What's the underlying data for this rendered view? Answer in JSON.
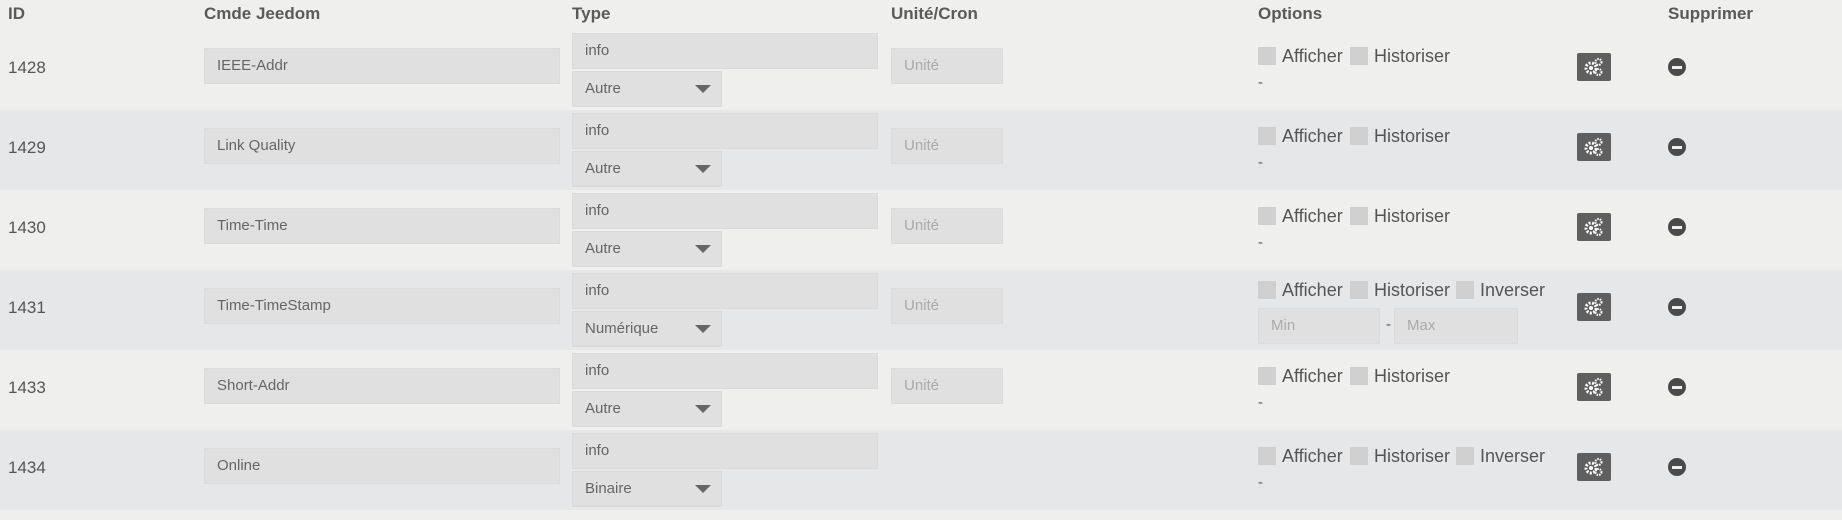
{
  "headers": {
    "id": "ID",
    "cmd": "Cmde Jeedom",
    "type": "Type",
    "unit": "Unité/Cron",
    "options": "Options",
    "delete": "Supprimer"
  },
  "unit_placeholder": "Unité",
  "labels": {
    "afficher": "Afficher",
    "historiser": "Historiser",
    "inverser": "Inverser",
    "dash": "-",
    "min": "Min",
    "max": "Max",
    "range_sep": "-"
  },
  "rows": [
    {
      "id": "1428",
      "name": "IEEE-Addr",
      "type": "info",
      "subtype": "Autre"
    },
    {
      "id": "1429",
      "name": "Link Quality",
      "type": "info",
      "subtype": "Autre"
    },
    {
      "id": "1430",
      "name": "Time-Time",
      "type": "info",
      "subtype": "Autre"
    },
    {
      "id": "1431",
      "name": "Time-TimeStamp",
      "type": "info",
      "subtype": "Numérique"
    },
    {
      "id": "1433",
      "name": "Short-Addr",
      "type": "info",
      "subtype": "Autre"
    },
    {
      "id": "1434",
      "name": "Online",
      "type": "info",
      "subtype": "Binaire"
    }
  ]
}
